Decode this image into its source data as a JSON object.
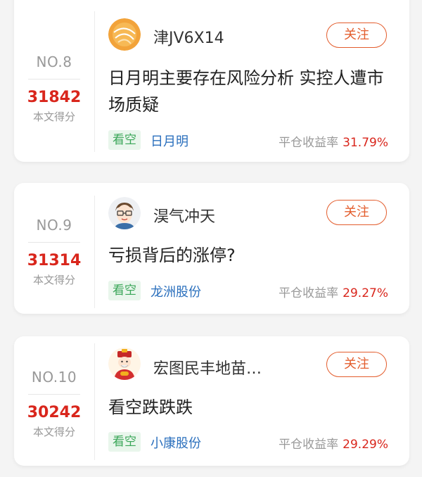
{
  "follow_label": "关注",
  "score_label": "本文得分",
  "return_label": "平仓收益率",
  "cards": [
    {
      "rank": "NO.8",
      "score": "31842",
      "username": "津JV6X14",
      "title": "日月明主要存在风险分析 实控人遭市场质疑",
      "badge": "看空",
      "stock": "日月明",
      "return_pct": "31.79%"
    },
    {
      "rank": "NO.9",
      "score": "31314",
      "username": "淏气冲天",
      "title": "亏损背后的涨停?",
      "badge": "看空",
      "stock": "龙洲股份",
      "return_pct": "29.27%"
    },
    {
      "rank": "NO.10",
      "score": "30242",
      "username": "宏图民丰地苗…",
      "title": "看空跌跌跌",
      "badge": "看空",
      "stock": "小康股份",
      "return_pct": "29.29%"
    }
  ],
  "colors": {
    "accent": "#e35d2d",
    "score": "#d9261c",
    "badge_text": "#3aa658",
    "stock_link": "#2a6fbd"
  }
}
